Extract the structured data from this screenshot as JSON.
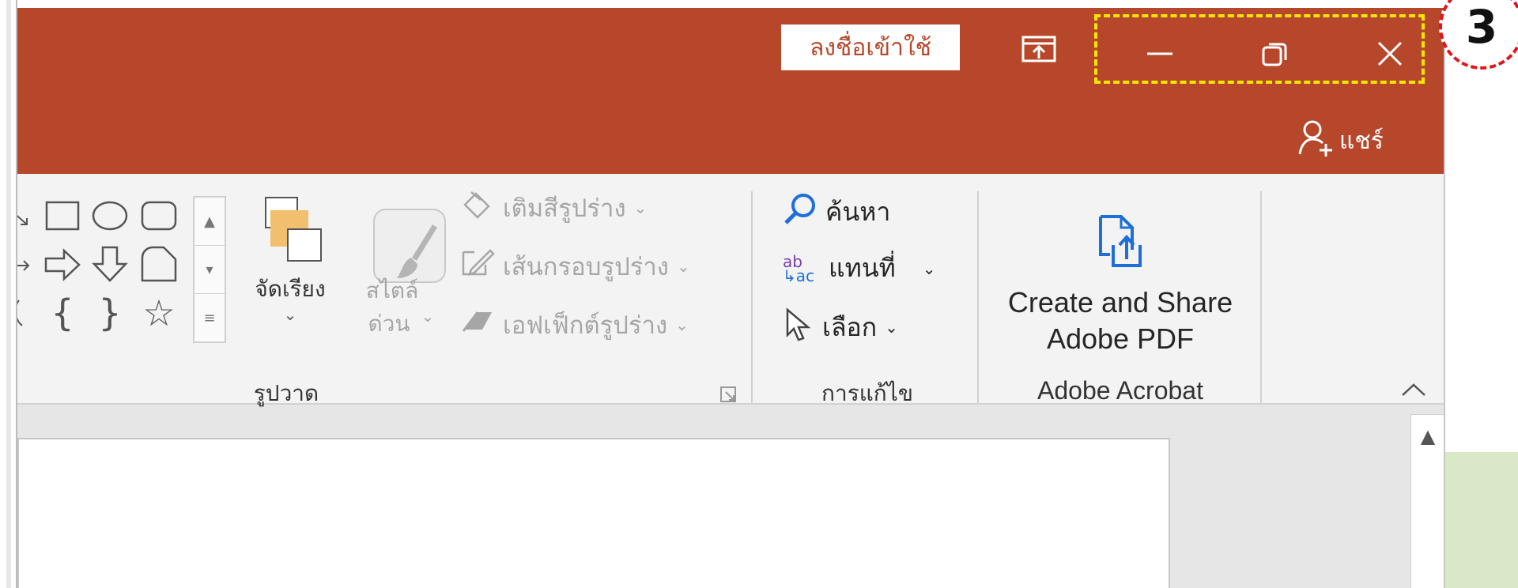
{
  "titlebar": {
    "signin_label": "ลงชื่อเข้าใช้",
    "share_label": "แชร์",
    "icons": [
      "ribbon-display-options-icon",
      "minimize-icon",
      "restore-icon",
      "close-icon",
      "add-person-icon"
    ]
  },
  "ribbon": {
    "drawing_group": {
      "arrange_label": "จัดเรียง",
      "quick_styles_label_1": "สไตล์",
      "quick_styles_label_2": "ด่วน",
      "shape_fill_label": "เติมสีรูปร่าง",
      "shape_outline_label": "เส้นกรอบรูปร่าง",
      "shape_effects_label": "เอฟเฟ็กต์รูปร่าง",
      "group_label": "รูปวาด"
    },
    "editing_group": {
      "find_label": "ค้นหา",
      "replace_label": "แทนที่",
      "select_label": "เลือก",
      "group_label": "การแก้ไข"
    },
    "adobe_group": {
      "create_share_line1": "Create and Share",
      "create_share_line2": "Adobe PDF",
      "group_label": "Adobe Acrobat"
    }
  },
  "annotation": {
    "step_number": "3"
  },
  "colors": {
    "titlebar": "#b7472a",
    "highlight_box": "#f3e600",
    "step_badge_border": "#e0161d",
    "background_green": "#d9e9c7",
    "adobe_icon": "#1e6fd9",
    "find_icon": "#1e6fd9"
  }
}
